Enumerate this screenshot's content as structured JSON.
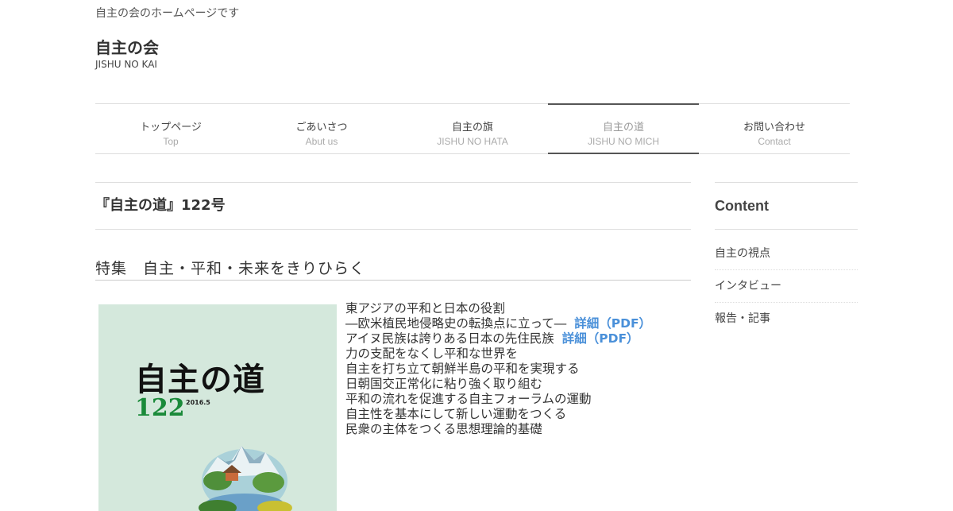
{
  "site": {
    "tagline": "自主の会のホームページです",
    "title": "自主の会",
    "subtitle": "JISHU NO KAI"
  },
  "nav": {
    "items": [
      {
        "jp": "トップページ",
        "en": "Top"
      },
      {
        "jp": "ごあいさつ",
        "en": "Abut us"
      },
      {
        "jp": "自主の旗",
        "en": "JISHU NO HATA"
      },
      {
        "jp": "自主の道",
        "en": "JISHU NO MICH"
      },
      {
        "jp": "お問い合わせ",
        "en": "Contact"
      }
    ],
    "current_index": 3
  },
  "main": {
    "entry_title": "『自主の道』122号",
    "feature_heading": "特集　自主・平和・未来をきりひらく",
    "cover": {
      "title": "自主の道",
      "number": "122",
      "date": "2016.5"
    },
    "toc": [
      {
        "text": "東アジアの平和と日本の役割"
      },
      {
        "text": "―欧米植民地侵略史の転換点に立って―",
        "link": "詳細（PDF）"
      },
      {
        "text": "アイヌ民族は誇りある日本の先住民族",
        "link": "詳細（PDF）"
      },
      {
        "text": "力の支配をなくし平和な世界を"
      },
      {
        "text": "自主を打ち立て朝鮮半島の平和を実現する"
      },
      {
        "text": "日朝国交正常化に粘り強く取り組む"
      },
      {
        "text": "平和の流れを促進する自主フォーラムの運動"
      },
      {
        "text": "自主性を基本にして新しい運動をつくる"
      },
      {
        "text": "民衆の主体をつくる思想理論的基礎"
      }
    ]
  },
  "sidebar": {
    "heading": "Content",
    "items": [
      "自主の視点",
      "インタビュー",
      "報告・記事"
    ]
  },
  "colors": {
    "link": "#4a90d9",
    "cover_background": "#d4e8dc",
    "cover_number": "#1a8a3a"
  }
}
